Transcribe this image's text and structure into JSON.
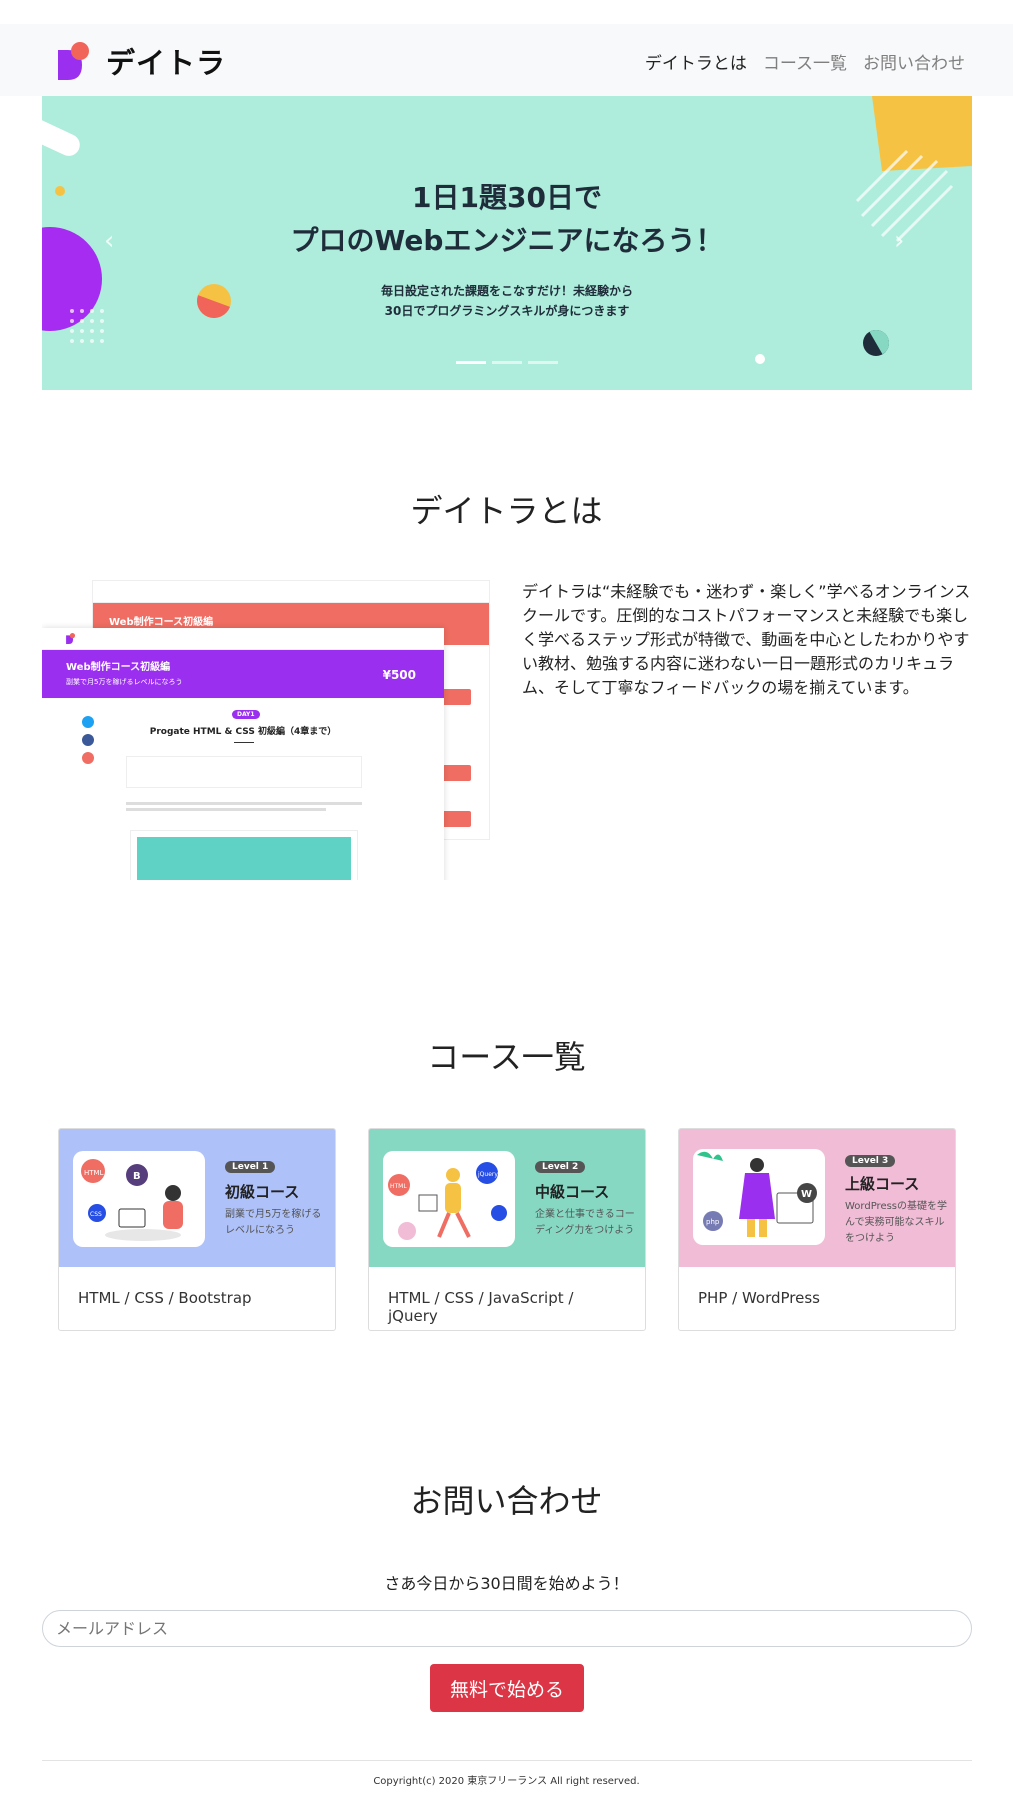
{
  "nav": {
    "brand": "デイトラ",
    "links": [
      "デイトラとは",
      "コース一覧",
      "お問い合わせ"
    ]
  },
  "hero": {
    "title_line1": "1日1題30日で",
    "title_line2": "プロのWebエンジニアになろう！",
    "sub_line1": "毎日設定された課題をこなすだけ！未経験から",
    "sub_line2": "30日でプログラミングスキルが身につきます",
    "prev_icon": "chevron-left-icon",
    "next_icon": "chevron-right-icon"
  },
  "about": {
    "title": "デイトラとは",
    "body": "デイトラは“未経験でも・迷わず・楽しく”学べるオンラインスクールです。圧倒的なコストパフォーマンスと未経験でも楽しく学べるステップ形式が特徴で、動画を中心としたわかりやすい教材、勉強する内容に迷わない一日一題形式のカリキュラム、そして丁寧なフィードバックの場を揃えています。",
    "screenshot": {
      "back_title": "Web制作コース初級編",
      "front_title": "Web制作コース初級編",
      "front_sub": "副業で月5万を稼げるレベルになろう",
      "price": "¥500",
      "day_badge": "DAY1",
      "lesson_title": "Progate HTML & CSS 初級編（4章まで）"
    }
  },
  "courses": {
    "title": "コース一覧",
    "items": [
      {
        "level": "Level 1",
        "name": "初級コース",
        "desc": "副業で月5万を稼げるレベルになろう",
        "tags": "HTML / CSS / Bootstrap",
        "bg": "#aec1f8",
        "badge": "#555"
      },
      {
        "level": "Level 2",
        "name": "中級コース",
        "desc": "企業と仕事できるコーディング力をつけよう",
        "tags": "HTML / CSS / JavaScript / jQuery",
        "bg": "#86d8c3",
        "badge": "#555"
      },
      {
        "level": "Level 3",
        "name": "上級コース",
        "desc": "WordPressの基礎を学んで実務可能なスキルをつけよう",
        "tags": "PHP / WordPress",
        "bg": "#f0bcd6",
        "badge": "#555"
      }
    ]
  },
  "contact": {
    "title": "お問い合わせ",
    "lead": "さあ今日から30日間を始めよう！",
    "placeholder": "メールアドレス",
    "button": "無料で始める"
  },
  "footer": {
    "copyright": "Copyright(c) 2020 東京フリーランス All right reserved."
  },
  "colors": {
    "hero_bg": "#aeecdb",
    "accent_red": "#dc3545",
    "nav_bg": "#f8f9fa"
  }
}
